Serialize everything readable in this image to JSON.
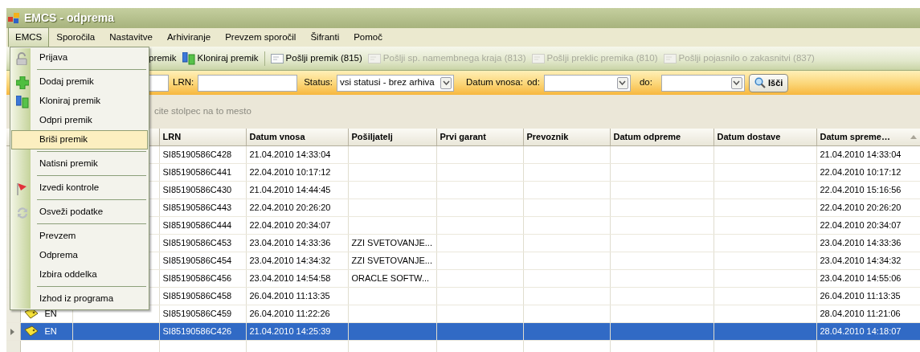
{
  "window": {
    "title": "EMCS - odprema"
  },
  "menu_bar": [
    {
      "label": "EMCS",
      "selected": true
    },
    {
      "label": "Sporočila",
      "selected": false
    },
    {
      "label": "Nastavitve",
      "selected": false
    },
    {
      "label": "Arhiviranje",
      "selected": false
    },
    {
      "label": "Prevzem sporočil",
      "selected": false
    },
    {
      "label": "Šifranti",
      "selected": false
    },
    {
      "label": "Pomoč",
      "selected": false
    }
  ],
  "toolbar": [
    {
      "kind": "button",
      "label": "premik",
      "disabled": false
    },
    {
      "kind": "button",
      "label": "Kloniraj premik",
      "disabled": false
    },
    {
      "kind": "separator"
    },
    {
      "kind": "button",
      "label": "Pošlji premik (815)",
      "disabled": false
    },
    {
      "kind": "button",
      "label": "Pošlji sp. namembnega kraja (813)",
      "disabled": true
    },
    {
      "kind": "button",
      "label": "Pošlji preklic premika (810)",
      "disabled": true
    },
    {
      "kind": "button",
      "label": "Pošlji pojasnilo o zakasnitvi (837)",
      "disabled": true
    }
  ],
  "filter": {
    "lrn_label": "LRN:",
    "status_label": "Status:",
    "status_value": "vsi statusi - brez arhiva",
    "date_label": "Datum vnosa:",
    "from_label": "od:",
    "to_label": "do:",
    "search_button": "Išči"
  },
  "group_hint": "cite stolpec na to mesto",
  "table": {
    "columns": [
      {
        "label": "LRN"
      },
      {
        "label": "Datum vnosa"
      },
      {
        "label": "Pošiljatelj"
      },
      {
        "label": "Prvi garant"
      },
      {
        "label": "Prevoznik"
      },
      {
        "label": "Datum odpreme"
      },
      {
        "label": "Datum dostave"
      },
      {
        "label": "Datum spreme…",
        "sorted": true
      }
    ],
    "rows": [
      {
        "selected": false,
        "cells": [
          "SI85190586C428",
          "21.04.2010 14:33:04",
          null,
          null,
          null,
          null,
          null,
          "21.04.2010 14:33:04"
        ]
      },
      {
        "selected": false,
        "cells": [
          "SI85190586C441",
          "22.04.2010 10:17:12",
          null,
          null,
          null,
          null,
          null,
          "22.04.2010 10:17:12"
        ]
      },
      {
        "selected": false,
        "cells": [
          "SI85190586C430",
          "21.04.2010 14:44:45",
          null,
          null,
          null,
          null,
          null,
          "22.04.2010 15:16:56"
        ]
      },
      {
        "selected": false,
        "cells": [
          "SI85190586C443",
          "22.04.2010 20:26:20",
          null,
          null,
          null,
          null,
          null,
          "22.04.2010 20:26:20"
        ]
      },
      {
        "selected": false,
        "cells": [
          "SI85190586C444",
          "22.04.2010 20:34:07",
          null,
          null,
          null,
          null,
          null,
          "22.04.2010 20:34:07"
        ]
      },
      {
        "selected": false,
        "cells": [
          "SI85190586C453",
          "23.04.2010 14:33:36",
          "ZZI SVETOVANJE...",
          null,
          null,
          null,
          null,
          "23.04.2010 14:33:36"
        ]
      },
      {
        "selected": false,
        "cells": [
          "SI85190586C454",
          "23.04.2010 14:34:32",
          "ZZI SVETOVANJE...",
          null,
          null,
          null,
          null,
          "23.04.2010 14:34:32"
        ]
      },
      {
        "selected": false,
        "cells": [
          "SI85190586C456",
          "23.04.2010 14:54:58",
          "ORACLE SOFTW...",
          null,
          null,
          null,
          null,
          "23.04.2010 14:55:06"
        ]
      },
      {
        "selected": false,
        "cells": [
          "SI85190586C458",
          "26.04.2010 11:13:35",
          null,
          null,
          null,
          null,
          null,
          "26.04.2010 11:13:35"
        ]
      },
      {
        "selected": false,
        "type": "EN",
        "cells": [
          "SI85190586C459",
          "26.04.2010 11:22:26",
          null,
          null,
          null,
          null,
          null,
          "28.04.2010 11:21:06"
        ]
      },
      {
        "selected": true,
        "type": "EN",
        "cells": [
          "SI85190586C426",
          "21.04.2010 14:25:39",
          null,
          null,
          null,
          null,
          null,
          "28.04.2010 14:18:07"
        ]
      }
    ]
  },
  "dropdown_menu": [
    {
      "kind": "item",
      "label": "Prijava",
      "selected": false
    },
    {
      "kind": "separator"
    },
    {
      "kind": "item",
      "label": "Dodaj premik",
      "selected": false
    },
    {
      "kind": "item",
      "label": "Kloniraj premik",
      "selected": false
    },
    {
      "kind": "item",
      "label": "Odpri premik",
      "selected": false
    },
    {
      "kind": "item",
      "label": "Briši premik",
      "selected": true
    },
    {
      "kind": "separator"
    },
    {
      "kind": "item",
      "label": "Natisni premik",
      "selected": false
    },
    {
      "kind": "separator"
    },
    {
      "kind": "item",
      "label": "Izvedi kontrole",
      "selected": false
    },
    {
      "kind": "separator"
    },
    {
      "kind": "item",
      "label": "Osveži podatke",
      "selected": false
    },
    {
      "kind": "separator"
    },
    {
      "kind": "item",
      "label": "Prevzem",
      "selected": false
    },
    {
      "kind": "item",
      "label": "Odprema",
      "selected": false
    },
    {
      "kind": "item",
      "label": "Izbira oddelka",
      "selected": false
    },
    {
      "kind": "separator"
    },
    {
      "kind": "item",
      "label": "Izhod iz programa",
      "selected": false
    }
  ]
}
